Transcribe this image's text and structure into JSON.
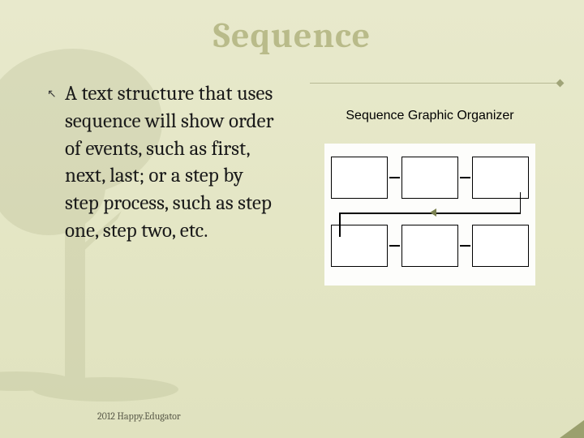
{
  "title": "Sequence",
  "body_text": "A text structure that uses sequence will show order of events, such as first, next, last; or a step by step process, such as step one, step two, etc.",
  "organizer_label": "Sequence Graphic Organizer",
  "footer": "2012 Happy.Edugator",
  "bullet_glyph": "↖"
}
